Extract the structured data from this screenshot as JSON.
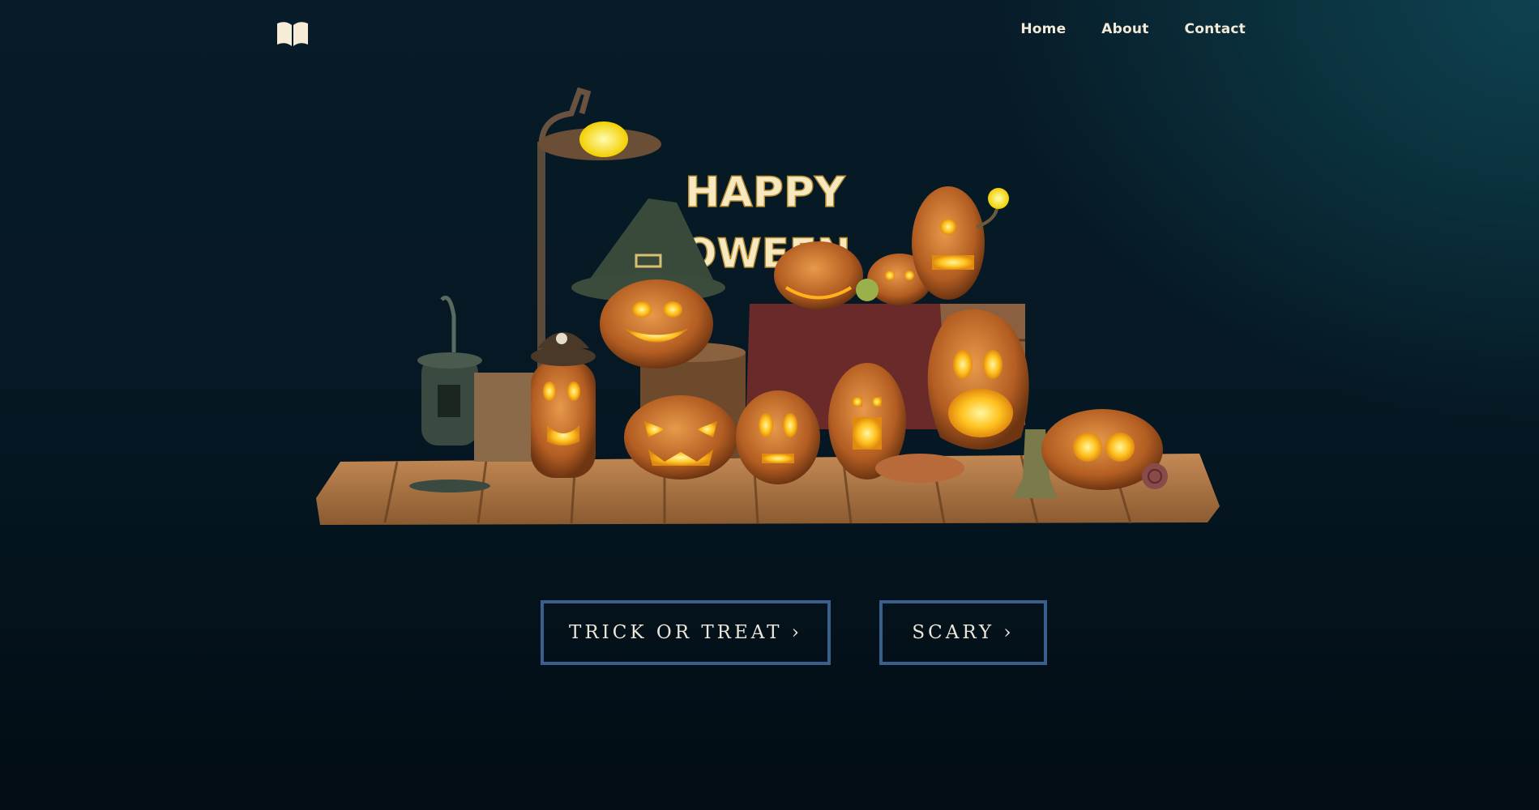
{
  "nav": {
    "logo_icon": "open-book-icon",
    "links": [
      {
        "label": "Home"
      },
      {
        "label": "About"
      },
      {
        "label": "Contact"
      }
    ]
  },
  "hero": {
    "sign_text_line1": "HAPPY",
    "sign_text_line2": "LLOWEEN",
    "image_description_icon": "halloween-pumpkin-scene"
  },
  "buttons": {
    "trick_label": "TRICK OR TREAT ›",
    "scary_label": "SCARY ›"
  },
  "colors": {
    "accent_border": "#3a5f8f",
    "text_light": "#f2ead8",
    "pumpkin_orange": "#d9772a",
    "glow_yellow": "#ffd43a"
  }
}
